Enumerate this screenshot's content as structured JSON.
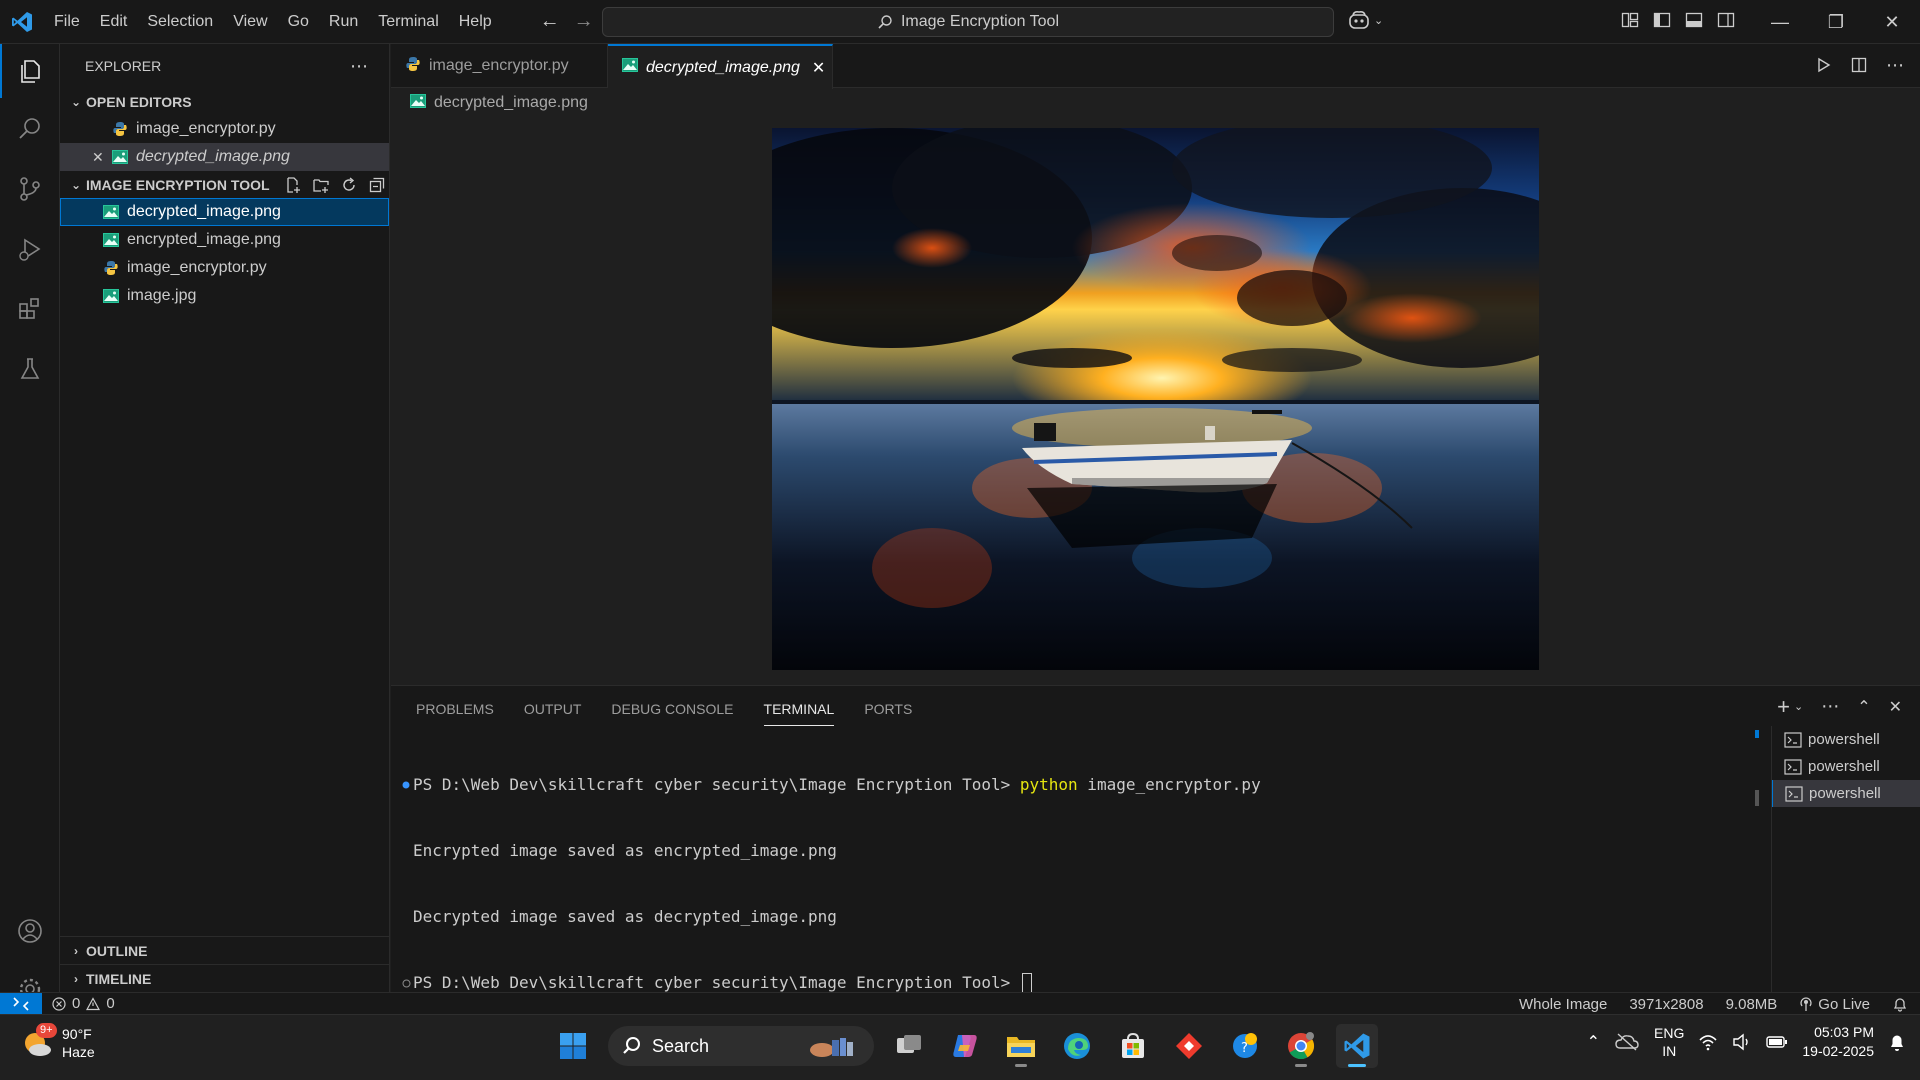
{
  "titlebar": {
    "menu": [
      "File",
      "Edit",
      "Selection",
      "View",
      "Go",
      "Run",
      "Terminal",
      "Help"
    ],
    "command_center": "Image Encryption Tool"
  },
  "sidebar": {
    "title": "EXPLORER",
    "open_editors_label": "OPEN EDITORS",
    "open_editors": [
      {
        "name": "image_encryptor.py",
        "icon": "python-file-icon"
      },
      {
        "name": "decrypted_image.png",
        "icon": "image-file-icon"
      }
    ],
    "folder_label": "IMAGE ENCRYPTION TOOL",
    "files": [
      {
        "name": "decrypted_image.png",
        "icon": "image-file-icon"
      },
      {
        "name": "encrypted_image.png",
        "icon": "image-file-icon"
      },
      {
        "name": "image_encryptor.py",
        "icon": "python-file-icon"
      },
      {
        "name": "image.jpg",
        "icon": "image-file-icon"
      }
    ],
    "outline_label": "OUTLINE",
    "timeline_label": "TIMELINE"
  },
  "editor": {
    "tabs": [
      {
        "label": "image_encryptor.py",
        "active": false
      },
      {
        "label": "decrypted_image.png",
        "active": true
      }
    ],
    "breadcrumb": "decrypted_image.png"
  },
  "panel": {
    "tabs": [
      "PROBLEMS",
      "OUTPUT",
      "DEBUG CONSOLE",
      "TERMINAL",
      "PORTS"
    ],
    "active_tab": "TERMINAL",
    "terminal": {
      "line1_prompt": "PS D:\\Web Dev\\skillcraft cyber security\\Image Encryption Tool> ",
      "line1_cmd": "python",
      "line1_arg": " image_encryptor.py",
      "line2": "Encrypted image saved as encrypted_image.png",
      "line3": "Decrypted image saved as decrypted_image.png",
      "line4_prompt": "PS D:\\Web Dev\\skillcraft cyber security\\Image Encryption Tool> "
    },
    "terminals": [
      "powershell",
      "powershell",
      "powershell"
    ]
  },
  "statusbar": {
    "errors": "0",
    "warnings": "0",
    "zoom": "Whole Image",
    "dimensions": "3971x2808",
    "size": "9.08MB",
    "go_live": "Go Live"
  },
  "taskbar": {
    "weather_badge": "9+",
    "temperature": "90°F",
    "condition": "Haze",
    "search_placeholder": "Search",
    "lang_top": "ENG",
    "lang_bottom": "IN",
    "time": "05:03 PM",
    "date": "19-02-2025"
  },
  "colors": {
    "accent": "#0078d4",
    "selection": "#04395e",
    "terminal_command": "#e5e510"
  }
}
